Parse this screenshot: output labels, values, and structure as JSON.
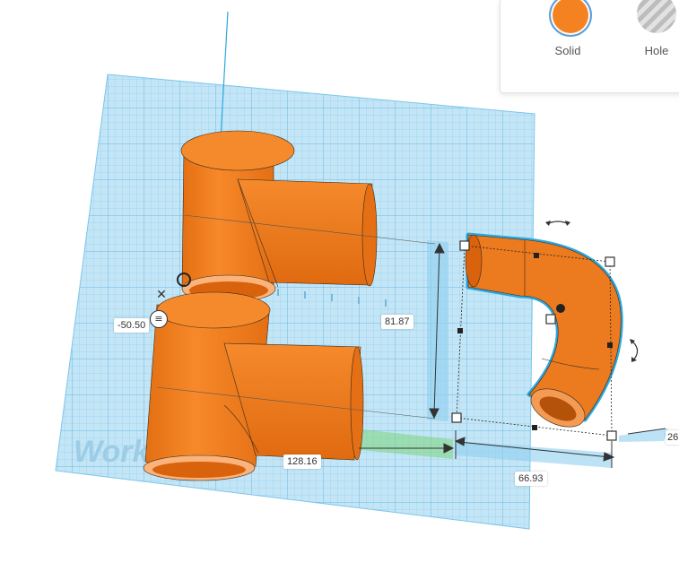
{
  "toolbar": {
    "solid_label": "Solid",
    "hole_label": "Hole",
    "solid_color": "#f58220"
  },
  "workplane": {
    "watermark": "Work"
  },
  "dimensions": {
    "position": "-50.50",
    "height": "81.87",
    "total_length": "128.16",
    "width": "66.93",
    "depth": "26"
  },
  "colors": {
    "grid": "#8fd0ee",
    "object": "#f58220",
    "selection": "#2aa8e0"
  }
}
